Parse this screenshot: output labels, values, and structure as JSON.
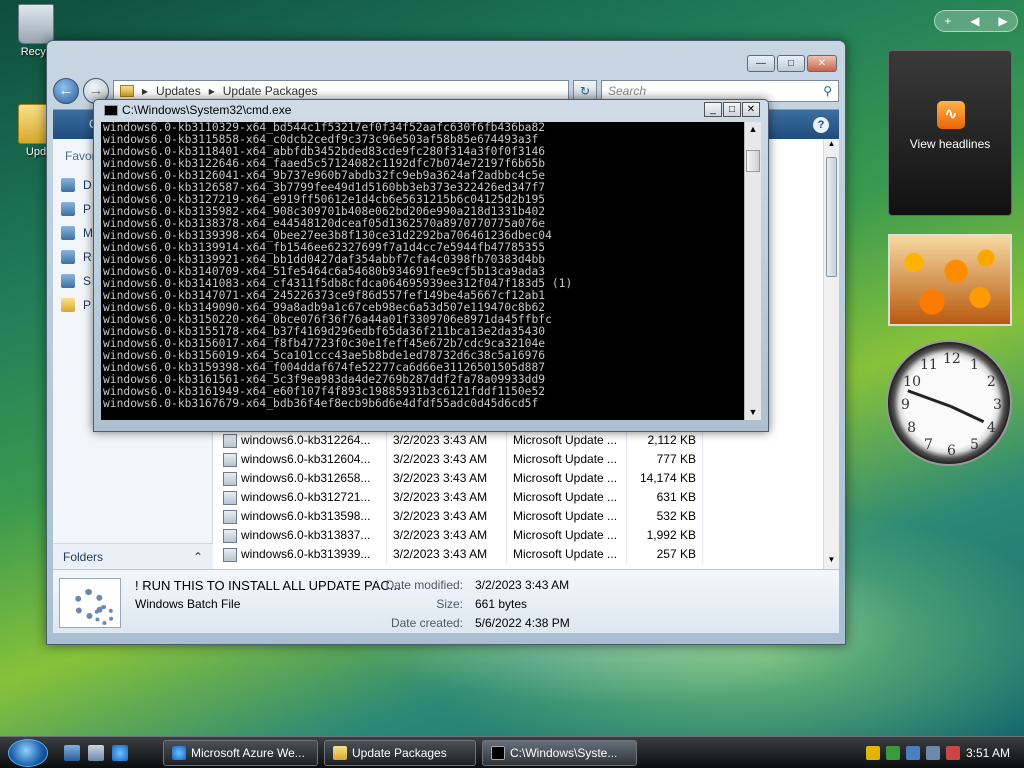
{
  "desktop": {
    "recycle_label": "Recyc",
    "folder_label": "Upd"
  },
  "explorer": {
    "address_parts": [
      "Updates",
      "Update Packages"
    ],
    "search_placeholder": "Search",
    "toolbar_first": "O",
    "favorites_label": "Favor",
    "favorites": [
      "D",
      "P",
      "M",
      "R",
      "S",
      "P"
    ],
    "folders_label": "Folders",
    "files": [
      {
        "name": "windows6.0-kb312264...",
        "date": "3/2/2023 3:43 AM",
        "type": "Microsoft Update ...",
        "size": "2,112 KB"
      },
      {
        "name": "windows6.0-kb312604...",
        "date": "3/2/2023 3:43 AM",
        "type": "Microsoft Update ...",
        "size": "777 KB"
      },
      {
        "name": "windows6.0-kb312658...",
        "date": "3/2/2023 3:43 AM",
        "type": "Microsoft Update ...",
        "size": "14,174 KB"
      },
      {
        "name": "windows6.0-kb312721...",
        "date": "3/2/2023 3:43 AM",
        "type": "Microsoft Update ...",
        "size": "631 KB"
      },
      {
        "name": "windows6.0-kb313598...",
        "date": "3/2/2023 3:43 AM",
        "type": "Microsoft Update ...",
        "size": "532 KB"
      },
      {
        "name": "windows6.0-kb313837...",
        "date": "3/2/2023 3:43 AM",
        "type": "Microsoft Update ...",
        "size": "1,992 KB"
      },
      {
        "name": "windows6.0-kb313939...",
        "date": "3/2/2023 3:43 AM",
        "type": "Microsoft Update ...",
        "size": "257 KB"
      }
    ],
    "details": {
      "name": "! RUN THIS TO INSTALL ALL UPDATE PAC...",
      "type": "Windows Batch File",
      "modified_label": "Date modified:",
      "modified_value": "3/2/2023 3:43 AM",
      "size_label": "Size:",
      "size_value": "661 bytes",
      "created_label": "Date created:",
      "created_value": "5/6/2022 4:38 PM"
    }
  },
  "cmd": {
    "title": "C:\\Windows\\System32\\cmd.exe",
    "lines": [
      "windows6.0-kb3110329-x64_bd544c1f53217ef0f34f52aafc630f6fb436ba82",
      "windows6.0-kb3115858-x64_c0dcb2cedf9c373c96e503af58b85e674493a3f",
      "windows6.0-kb3118401-x64_abbfdb3452bded83cde9fc280f314a3f0f0f3146",
      "windows6.0-kb3122646-x64_faaed5c57124082c1192dfc7b074e72197f6b65b",
      "windows6.0-kb3126041-x64_9b737e960b7abdb32fc9eb9a3624af2adbbc4c5e",
      "windows6.0-kb3126587-x64_3b7799fee49d1d5160bb3eb373e322426ed347f7",
      "windows6.0-kb3127219-x64_e919ff50612e1d4cb6e5631215b6c04125d2b195",
      "windows6.0-kb3135982-x64_908c309701b408e062bd206e990a218d1331b402",
      "windows6.0-kb3138378-x64_e44548120dceaf05d1362570a8970770775a076e",
      "windows6.0-kb3139398-x64_0bee27ee3b8f130ce31d2292ba706461236dbec04",
      "windows6.0-kb3139914-x64_fb1546ee62327699f7a1d4cc7e5944fb47785355",
      "windows6.0-kb3139921-x64_bb1dd0427daf354abbf7cfa4c0398fb70383d4bb",
      "windows6.0-kb3140709-x64_51fe5464c6a54680b934691fee9cf5b13ca9ada3",
      "windows6.0-kb3141083-x64_cf4311f5db8cfdca064695939ee312f047f183d5 (1)",
      "windows6.0-kb3147071-x64_245226373ce9f86d557fef149be4a5667cf12ab1",
      "windows6.0-kb3149090-x64_99a8adb9a1c67ceb98ec6a53d507e119470c8b62",
      "windows6.0-kb3150220-x64_0bce076f36f76a44a01f3309706e8971da45ffbfc",
      "windows6.0-kb3155178-x64_b37f4169d296edbf65da36f211bca13e2da35430",
      "windows6.0-kb3156017-x64_f8fb47723f0c30e1feff45e672b7cdc9ca32104e",
      "windows6.0-kb3156019-x64_5ca101ccc43ae5b8bde1ed78732d6c38c5a16976",
      "windows6.0-kb3159398-x64_f004ddaf674fe52277ca6d66e31126501505d887",
      "windows6.0-kb3161561-x64_5c3f9ea983da4de2769b287ddf2fa78a09933dd9",
      "windows6.0-kb3161949-x64_e60f107f4f893c19885931b3c6121fddf1150e52",
      "windows6.0-kb3167679-x64_bdb36f4ef8ecb9b6d6e4dfdf55adc0d45d6cd5f"
    ]
  },
  "gadgets": {
    "feed_label": "View headlines",
    "clock_numbers": [
      "12",
      "1",
      "2",
      "3",
      "4",
      "5",
      "6",
      "7",
      "8",
      "9",
      "10",
      "11"
    ]
  },
  "taskbar": {
    "buttons": [
      "Microsoft Azure We...",
      "Update Packages",
      "C:\\Windows\\Syste..."
    ],
    "clock": "3:51 AM"
  },
  "colors": {
    "console_bg": "#000000",
    "console_fg": "#c8c8c8",
    "toolbar": "#2a5b8c"
  }
}
